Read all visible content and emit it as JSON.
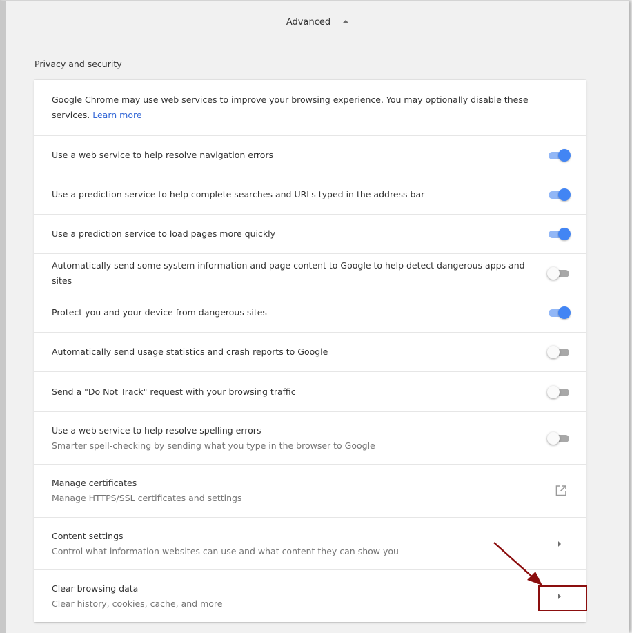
{
  "header": {
    "advanced_label": "Advanced"
  },
  "section": {
    "title": "Privacy and security"
  },
  "intro": {
    "text": "Google Chrome may use web services to improve your browsing experience. You may optionally disable these services.",
    "link": "Learn more"
  },
  "settings": [
    {
      "label": "Use a web service to help resolve navigation errors",
      "enabled": true
    },
    {
      "label": "Use a prediction service to help complete searches and URLs typed in the address bar",
      "enabled": true
    },
    {
      "label": "Use a prediction service to load pages more quickly",
      "enabled": true
    },
    {
      "label": "Automatically send some system information and page content to Google to help detect dangerous apps and sites",
      "enabled": false
    },
    {
      "label": "Protect you and your device from dangerous sites",
      "enabled": true
    },
    {
      "label": "Automatically send usage statistics and crash reports to Google",
      "enabled": false
    },
    {
      "label": "Send a \"Do Not Track\" request with your browsing traffic",
      "enabled": false
    },
    {
      "label": "Use a web service to help resolve spelling errors",
      "sub": "Smarter spell-checking by sending what you type in the browser to Google",
      "enabled": false
    }
  ],
  "certificates": {
    "label": "Manage certificates",
    "sub": "Manage HTTPS/SSL certificates and settings",
    "icon": "open-in-new-icon"
  },
  "content_settings": {
    "label": "Content settings",
    "sub": "Control what information websites can use and what content they can show you",
    "icon": "chevron-right-icon"
  },
  "clear_data": {
    "label": "Clear browsing data",
    "sub": "Clear history, cookies, cache, and more",
    "icon": "chevron-right-icon"
  },
  "colors": {
    "toggle_on_knob": "#4285f4",
    "toggle_on_track": "#92b7f6",
    "toggle_off_track": "#a8a8a8",
    "link": "#3367d6",
    "annotation": "#8b0e0e"
  }
}
